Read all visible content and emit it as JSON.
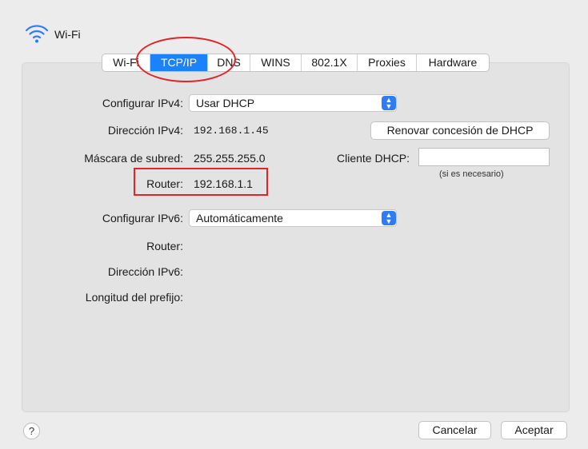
{
  "header": {
    "title": "Wi-Fi",
    "icon": "wifi-icon"
  },
  "tabs": [
    {
      "label": "Wi-Fi",
      "active": false
    },
    {
      "label": "TCP/IP",
      "active": true
    },
    {
      "label": "DNS",
      "active": false
    },
    {
      "label": "WINS",
      "active": false
    },
    {
      "label": "802.1X",
      "active": false
    },
    {
      "label": "Proxies",
      "active": false
    },
    {
      "label": "Hardware",
      "active": false
    }
  ],
  "ipv4": {
    "config_label": "Configurar IPv4:",
    "config_value": "Usar DHCP",
    "address_label": "Dirección IPv4:",
    "address_value": "192.168.1.45",
    "renew_button": "Renovar concesión de DHCP",
    "mask_label": "Máscara de subred:",
    "mask_value": "255.255.255.0",
    "dhcp_client_label": "Cliente DHCP:",
    "dhcp_client_value": "",
    "dhcp_hint": "(si es necesario)",
    "router_label": "Router:",
    "router_value": "192.168.1.1"
  },
  "ipv6": {
    "config_label": "Configurar IPv6:",
    "config_value": "Automáticamente",
    "router_label": "Router:",
    "address_label": "Dirección IPv6:",
    "prefix_label": "Longitud del prefijo:"
  },
  "footer": {
    "help": "?",
    "cancel": "Cancelar",
    "accept": "Aceptar"
  },
  "colors": {
    "accent": "#1a82fb",
    "highlight": "#e0252a"
  }
}
